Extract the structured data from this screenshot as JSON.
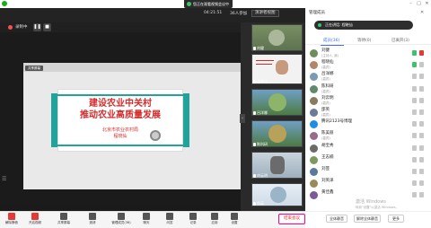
{
  "system": {
    "notice_text": "您正在观看视频会议中"
  },
  "status_bar": {
    "timer": "04:21:51",
    "members": "36人参加",
    "view_button": "演讲者视图"
  },
  "recording": {
    "label": "录制中"
  },
  "slide": {
    "tag": "共享屏幕",
    "title_line1": "建设农业中关村",
    "title_line2": "推动农业高质量发展",
    "org": "北京市农业农村局",
    "speaker": "程晓仙"
  },
  "thumbnails": [
    {
      "label": "刘健"
    },
    {
      "label": "程晓仙"
    },
    {
      "label": "吕洋娜"
    },
    {
      "label": "陈科研"
    },
    {
      "label": "刘云明"
    },
    {
      "label": "邵英"
    }
  ],
  "panel": {
    "title": "管理成员",
    "speaking_text": "正在讲话: 程晓仙",
    "tabs": [
      "成员(36)",
      "等待(0)",
      "已离开(3)"
    ],
    "members": [
      {
        "name": "刘健",
        "role": "(主持人, 我)",
        "color": "#6b8e5a"
      },
      {
        "name": "程晓仙",
        "role": "(嘉宾)",
        "color": "#b4846c"
      },
      {
        "name": "吕洋娜",
        "role": "(嘉宾)",
        "color": "#7a9ab5"
      },
      {
        "name": "陈科研",
        "role": "(嘉宾)",
        "color": "#5e8a6a"
      },
      {
        "name": "刘云明",
        "role": "(嘉宾)",
        "color": "#8a7a5e"
      },
      {
        "name": "邵英",
        "role": "(嘉宾)",
        "color": "#6a7c9a"
      },
      {
        "name": "腾讯2123号博理",
        "role": "",
        "color": "#1f8ee0"
      },
      {
        "name": "陈美丽",
        "role": "(嘉宾)",
        "color": "#9a6a8a"
      },
      {
        "name": "胡宝秀",
        "role": "",
        "color": "#6a6a6a"
      },
      {
        "name": "王志楠",
        "role": "",
        "color": "#7d9a5e"
      },
      {
        "name": "刘芸",
        "role": "",
        "color": "#5a7a9a"
      },
      {
        "name": "刘英泽",
        "role": "",
        "color": "#9a8a5a"
      },
      {
        "name": "黄佳鑫",
        "role": "",
        "color": "#7a5a9a"
      }
    ],
    "activate_title": "激活 Windows",
    "activate_sub": "转到\"设置\"以激活 Windows。",
    "foot_buttons": [
      "全体静音",
      "解除全体静音",
      "更多"
    ]
  },
  "toolbar": {
    "items": [
      "解除静音",
      "开启视频",
      "共享屏幕",
      "邀请",
      "管理成员(36)",
      "聊天",
      "问答",
      "记录",
      "应用",
      "设置"
    ],
    "leave": "结束会议"
  }
}
